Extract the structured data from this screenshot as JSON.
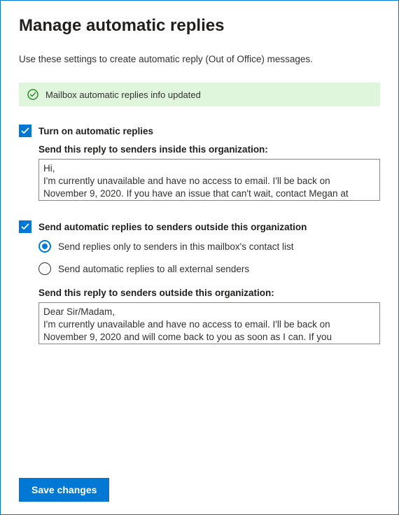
{
  "title": "Manage automatic replies",
  "description": "Use these settings to create automatic reply (Out of Office) messages.",
  "success_message": "Mailbox automatic replies info updated",
  "turn_on": {
    "label": "Turn on automatic replies",
    "checked": true
  },
  "inside": {
    "label": "Send this reply to senders inside this organization:",
    "text": "Hi,\nI'm currently unavailable and have no access to email. I'll be back on November 9, 2020. If you have an issue that can't wait, contact Megan at"
  },
  "outside_enable": {
    "label": "Send automatic replies to senders outside this organization",
    "checked": true
  },
  "outside_scope": {
    "contacts_only_label": "Send replies only to senders in this mailbox's contact list",
    "all_external_label": "Send automatic replies to all external senders",
    "selected": "contacts_only"
  },
  "outside": {
    "label": "Send this reply to senders outside this organization:",
    "text": "Dear Sir/Madam,\nI'm currently unavailable and have no access to email. I'll be back on November 9, 2020 and will come back to you as soon as I can. If you"
  },
  "save_button": "Save changes"
}
